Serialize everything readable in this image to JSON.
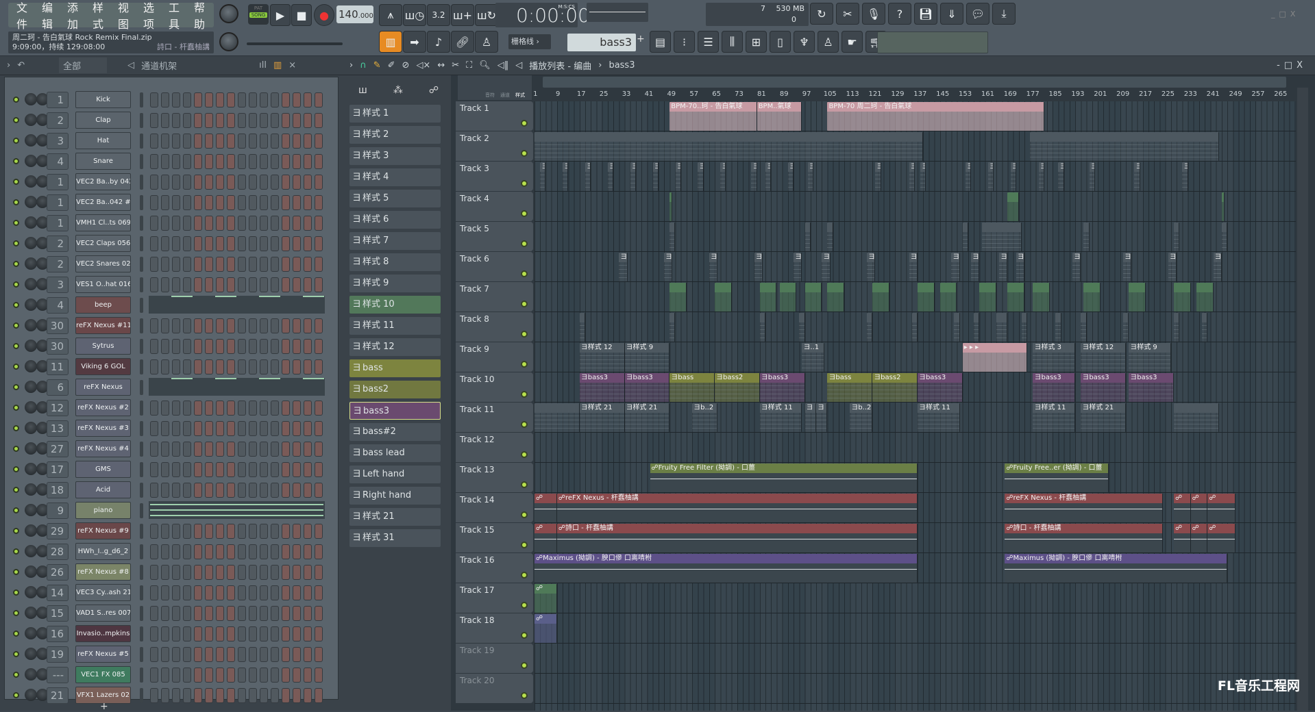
{
  "menu": [
    "文件",
    "编辑",
    "添加",
    "样式",
    "视图",
    "选项",
    "工具",
    "帮助"
  ],
  "hint": {
    "line1": "周二珂 - 告白氣球 Rock Remix Final.zip",
    "line2": "9:09:00，持续 129:08:00",
    "line3": "詩口 - 杆蠢柚講"
  },
  "transport": {
    "pat": "PAT",
    "song": "SONG",
    "tempo": "140",
    "tempo_frac": ".000",
    "time": "0:00:00",
    "time_unit": "M:S:CS",
    "cpu": "7",
    "mem": "530 MB",
    "poly": "0"
  },
  "snap": "栅格线",
  "pattern_selector": "bass3",
  "rack": {
    "filter": "全部",
    "title": "通道机架"
  },
  "playlist": {
    "title": "播放列表 - 编曲",
    "pattern": "bass3",
    "col_labels": [
      "音符",
      "通道",
      "样式"
    ]
  },
  "channels": [
    {
      "num": "1",
      "name": "Kick",
      "color": "#5b646c"
    },
    {
      "num": "2",
      "name": "Clap",
      "color": "#5b646c"
    },
    {
      "num": "3",
      "name": "Hat",
      "color": "#5b646c"
    },
    {
      "num": "4",
      "name": "Snare",
      "color": "#5b646c"
    },
    {
      "num": "1",
      "name": "VEC2 Ba..by 042",
      "color": "#5b646c"
    },
    {
      "num": "1",
      "name": "VEC2 Ba..042 #2",
      "color": "#5b646c"
    },
    {
      "num": "1",
      "name": "VMH1 Cl..ts 069",
      "color": "#5b646c"
    },
    {
      "num": "2",
      "name": "VEC2 Claps 056",
      "color": "#5b646c"
    },
    {
      "num": "2",
      "name": "VEC2 Snares 020",
      "color": "#5b646c"
    },
    {
      "num": "3",
      "name": "VES1 O..hat 016",
      "color": "#5b646c"
    },
    {
      "num": "4",
      "name": "beep",
      "color": "#6d4c4d",
      "roll": true
    },
    {
      "num": "30",
      "name": "reFX Nexus #11",
      "color": "#6a4749"
    },
    {
      "num": "30",
      "name": "Sytrus",
      "color": "#5e6372"
    },
    {
      "num": "11",
      "name": "Viking 6 GOL",
      "color": "#533a41"
    },
    {
      "num": "6",
      "name": "reFX Nexus",
      "color": "#5e6372",
      "roll": true
    },
    {
      "num": "12",
      "name": "reFX Nexus #2",
      "color": "#5e6372"
    },
    {
      "num": "13",
      "name": "reFX Nexus #3",
      "color": "#5e6372"
    },
    {
      "num": "27",
      "name": "reFX Nexus #4",
      "color": "#5e6372"
    },
    {
      "num": "17",
      "name": "GMS",
      "color": "#5e6372"
    },
    {
      "num": "18",
      "name": "Acid",
      "color": "#5e6372"
    },
    {
      "num": "9",
      "name": "piano",
      "color": "#77826a",
      "roll": "lines"
    },
    {
      "num": "29",
      "name": "reFX Nexus #9",
      "color": "#6a4749"
    },
    {
      "num": "28",
      "name": "HWh_I..g_d6_2",
      "color": "#5b646c"
    },
    {
      "num": "26",
      "name": "reFX Nexus #8",
      "color": "#7b8567"
    },
    {
      "num": "14",
      "name": "VEC3 Cy..ash 21",
      "color": "#5b646c"
    },
    {
      "num": "15",
      "name": "VAD1 S..res 007",
      "color": "#5b646c"
    },
    {
      "num": "16",
      "name": "Invasio..mpkins",
      "color": "#4e3641"
    },
    {
      "num": "19",
      "name": "reFX Nexus #5",
      "color": "#5e6372"
    },
    {
      "num": "---",
      "name": "VEC1 FX 085",
      "color": "#3f7b5f"
    },
    {
      "num": "21",
      "name": "VFX1 Lazers 02",
      "color": "#7a5f58"
    }
  ],
  "patterns": [
    {
      "name": "样式 1",
      "color": "#4a535b"
    },
    {
      "name": "样式 2",
      "color": "#4a535b"
    },
    {
      "name": "样式 3",
      "color": "#4a535b"
    },
    {
      "name": "样式 4",
      "color": "#4a535b"
    },
    {
      "name": "样式 5",
      "color": "#4a535b"
    },
    {
      "name": "样式 6",
      "color": "#4a535b"
    },
    {
      "name": "样式 7",
      "color": "#4a535b"
    },
    {
      "name": "样式 8",
      "color": "#4a535b"
    },
    {
      "name": "样式 9",
      "color": "#4a535b"
    },
    {
      "name": "样式 10",
      "color": "#52785a"
    },
    {
      "name": "样式 11",
      "color": "#4a535b"
    },
    {
      "name": "样式 12",
      "color": "#4a535b"
    },
    {
      "name": "bass",
      "color": "#7d843f"
    },
    {
      "name": "bass2",
      "color": "#717840"
    },
    {
      "name": "bass3",
      "color": "#6a4a6f",
      "selected": true
    },
    {
      "name": "bass#2",
      "color": "#4a535b"
    },
    {
      "name": "bass lead",
      "color": "#4a535b"
    },
    {
      "name": "Left hand",
      "color": "#4a535b"
    },
    {
      "name": "Right hand",
      "color": "#4a535b"
    },
    {
      "name": "样式 21",
      "color": "#4a535b"
    },
    {
      "name": "样式 31",
      "color": "#4a535b"
    }
  ],
  "ruler": [
    "1",
    "9",
    "17",
    "25",
    "33",
    "41",
    "49",
    "57",
    "65",
    "73",
    "81",
    "89",
    "97",
    "105",
    "113",
    "121",
    "129",
    "137",
    "145",
    "153",
    "161",
    "169",
    "177",
    "185",
    "193",
    "201",
    "209",
    "217",
    "225",
    "233",
    "241",
    "249",
    "257",
    "265"
  ],
  "tracks": [
    "Track 1",
    "Track 2",
    "Track 3",
    "Track 4",
    "Track 5",
    "Track 6",
    "Track 7",
    "Track 8",
    "Track 9",
    "Track 10",
    "Track 11",
    "Track 12",
    "Track 13",
    "Track 14",
    "Track 15",
    "Track 16",
    "Track 17",
    "Track 18",
    "Track 19",
    "Track 20"
  ],
  "clip_colors": {
    "audio": "#c79aa3",
    "pattern": "#4d5860",
    "green": "#4f7a58",
    "bass": "#7d843f",
    "bass3": "#6b4a70",
    "auto": "#8b4a4d",
    "max": "#5d5088",
    "filter": "#6b7f46",
    "blue": "#5a5f8a"
  },
  "clips": [
    {
      "t": 0,
      "s": 49,
      "e": 80,
      "k": "audio",
      "label": "BPM-70..珂 - 告白氣球"
    },
    {
      "t": 0,
      "s": 80,
      "e": 96,
      "k": "audio",
      "label": "BPM..氣球"
    },
    {
      "t": 0,
      "s": 105,
      "e": 182,
      "k": "audio",
      "label": "BPM-70 周二珂 - 告白氣球"
    },
    {
      "t": 1,
      "s": 1,
      "e": 139,
      "k": "pattern",
      "label": ""
    },
    {
      "t": 1,
      "s": 177,
      "e": 244,
      "k": "pattern",
      "label": ""
    },
    {
      "t": 2,
      "s": 3,
      "e": 5,
      "k": "pattern",
      "label": "ヨ"
    },
    {
      "t": 2,
      "s": 11,
      "e": 13,
      "k": "pattern",
      "label": "ヨ"
    },
    {
      "t": 2,
      "s": 19,
      "e": 21,
      "k": "pattern",
      "label": "ヨ"
    },
    {
      "t": 2,
      "s": 27,
      "e": 29,
      "k": "pattern",
      "label": "ヨ"
    },
    {
      "t": 2,
      "s": 35,
      "e": 37,
      "k": "pattern",
      "label": "ヨ"
    },
    {
      "t": 2,
      "s": 43,
      "e": 45,
      "k": "pattern",
      "label": "ヨ"
    },
    {
      "t": 2,
      "s": 51,
      "e": 53,
      "k": "pattern",
      "label": "ヨ"
    },
    {
      "t": 2,
      "s": 59,
      "e": 61,
      "k": "pattern",
      "label": "ヨ"
    },
    {
      "t": 2,
      "s": 67,
      "e": 69,
      "k": "pattern",
      "label": "ヨ"
    },
    {
      "t": 2,
      "s": 78,
      "e": 80,
      "k": "pattern",
      "label": "ヨ"
    },
    {
      "t": 2,
      "s": 83,
      "e": 85,
      "k": "pattern",
      "label": "ヨ"
    },
    {
      "t": 2,
      "s": 91,
      "e": 93,
      "k": "pattern",
      "label": "ヨ"
    },
    {
      "t": 2,
      "s": 98,
      "e": 100,
      "k": "pattern",
      "label": "ヨ"
    },
    {
      "t": 2,
      "s": 122,
      "e": 124,
      "k": "pattern",
      "label": "ヨ"
    },
    {
      "t": 2,
      "s": 134,
      "e": 136,
      "k": "pattern",
      "label": "ヨ"
    },
    {
      "t": 2,
      "s": 138,
      "e": 140,
      "k": "pattern",
      "label": "ヨ"
    },
    {
      "t": 2,
      "s": 154,
      "e": 156,
      "k": "pattern",
      "label": "ヨ"
    },
    {
      "t": 2,
      "s": 162,
      "e": 164,
      "k": "pattern",
      "label": "ヨ"
    },
    {
      "t": 2,
      "s": 170,
      "e": 172,
      "k": "pattern",
      "label": "ヨ"
    },
    {
      "t": 2,
      "s": 180,
      "e": 182,
      "k": "pattern",
      "label": "ヨ"
    },
    {
      "t": 2,
      "s": 187,
      "e": 189,
      "k": "pattern",
      "label": "ヨ"
    },
    {
      "t": 2,
      "s": 198,
      "e": 200,
      "k": "pattern",
      "label": "ヨ"
    },
    {
      "t": 2,
      "s": 214,
      "e": 216,
      "k": "pattern",
      "label": "ヨ"
    },
    {
      "t": 2,
      "s": 231,
      "e": 233,
      "k": "pattern",
      "label": "ヨ"
    },
    {
      "t": 3,
      "s": 49,
      "e": 50,
      "k": "green",
      "label": ""
    },
    {
      "t": 3,
      "s": 169,
      "e": 173,
      "k": "green",
      "label": ""
    },
    {
      "t": 3,
      "s": 245,
      "e": 246,
      "k": "green",
      "label": ""
    },
    {
      "t": 4,
      "s": 49,
      "e": 51,
      "k": "pattern",
      "label": ""
    },
    {
      "t": 4,
      "s": 97,
      "e": 99,
      "k": "pattern",
      "label": ""
    },
    {
      "t": 4,
      "s": 105,
      "e": 107,
      "k": "pattern",
      "label": ""
    },
    {
      "t": 4,
      "s": 153,
      "e": 155,
      "k": "pattern",
      "label": ""
    },
    {
      "t": 4,
      "s": 160,
      "e": 174,
      "k": "pattern",
      "label": ""
    },
    {
      "t": 4,
      "s": 196,
      "e": 198,
      "k": "pattern",
      "label": ""
    },
    {
      "t": 4,
      "s": 228,
      "e": 230,
      "k": "pattern",
      "label": ""
    },
    {
      "t": 4,
      "s": 245,
      "e": 247,
      "k": "pattern",
      "label": ""
    },
    {
      "t": 5,
      "s": 31,
      "e": 34,
      "k": "pattern",
      "label": "ヨ"
    },
    {
      "t": 5,
      "s": 47,
      "e": 50,
      "k": "pattern",
      "label": "ヨ"
    },
    {
      "t": 5,
      "s": 63,
      "e": 66,
      "k": "pattern",
      "label": "ヨ"
    },
    {
      "t": 5,
      "s": 79,
      "e": 82,
      "k": "pattern",
      "label": "ヨ"
    },
    {
      "t": 5,
      "s": 93,
      "e": 96,
      "k": "pattern",
      "label": "ヨ"
    },
    {
      "t": 5,
      "s": 103,
      "e": 106,
      "k": "pattern",
      "label": "ヨ"
    },
    {
      "t": 5,
      "s": 119,
      "e": 122,
      "k": "pattern",
      "label": "ヨ"
    },
    {
      "t": 5,
      "s": 134,
      "e": 137,
      "k": "pattern",
      "label": "ヨ"
    },
    {
      "t": 5,
      "s": 149,
      "e": 152,
      "k": "pattern",
      "label": "ヨ"
    },
    {
      "t": 5,
      "s": 156,
      "e": 159,
      "k": "pattern",
      "label": "ヨ"
    },
    {
      "t": 5,
      "s": 166,
      "e": 169,
      "k": "pattern",
      "label": "ヨ"
    },
    {
      "t": 5,
      "s": 172,
      "e": 175,
      "k": "pattern",
      "label": "ヨ"
    },
    {
      "t": 5,
      "s": 192,
      "e": 195,
      "k": "pattern",
      "label": "ヨ"
    },
    {
      "t": 5,
      "s": 210,
      "e": 213,
      "k": "pattern",
      "label": "ヨ"
    },
    {
      "t": 5,
      "s": 226,
      "e": 229,
      "k": "pattern",
      "label": "ヨ"
    },
    {
      "t": 5,
      "s": 242,
      "e": 245,
      "k": "pattern",
      "label": "ヨ"
    },
    {
      "t": 6,
      "s": 49,
      "e": 55,
      "k": "green",
      "label": ""
    },
    {
      "t": 6,
      "s": 65,
      "e": 71,
      "k": "green",
      "label": ""
    },
    {
      "t": 6,
      "s": 81,
      "e": 87,
      "k": "green",
      "label": ""
    },
    {
      "t": 6,
      "s": 88,
      "e": 94,
      "k": "green",
      "label": ""
    },
    {
      "t": 6,
      "s": 97,
      "e": 103,
      "k": "green",
      "label": ""
    },
    {
      "t": 6,
      "s": 105,
      "e": 111,
      "k": "green",
      "label": ""
    },
    {
      "t": 6,
      "s": 121,
      "e": 127,
      "k": "green",
      "label": ""
    },
    {
      "t": 6,
      "s": 137,
      "e": 143,
      "k": "green",
      "label": ""
    },
    {
      "t": 6,
      "s": 145,
      "e": 151,
      "k": "green",
      "label": ""
    },
    {
      "t": 6,
      "s": 159,
      "e": 165,
      "k": "green",
      "label": ""
    },
    {
      "t": 6,
      "s": 169,
      "e": 175,
      "k": "green",
      "label": ""
    },
    {
      "t": 6,
      "s": 178,
      "e": 184,
      "k": "green",
      "label": ""
    },
    {
      "t": 6,
      "s": 196,
      "e": 202,
      "k": "green",
      "label": ""
    },
    {
      "t": 6,
      "s": 212,
      "e": 218,
      "k": "green",
      "label": ""
    },
    {
      "t": 6,
      "s": 228,
      "e": 234,
      "k": "green",
      "label": ""
    },
    {
      "t": 6,
      "s": 236,
      "e": 242,
      "k": "green",
      "label": ""
    },
    {
      "t": 7,
      "s": 17,
      "e": 19,
      "k": "pattern",
      "label": ""
    },
    {
      "t": 7,
      "s": 49,
      "e": 51,
      "k": "pattern",
      "label": ""
    },
    {
      "t": 7,
      "s": 81,
      "e": 83,
      "k": "pattern",
      "label": ""
    },
    {
      "t": 7,
      "s": 95,
      "e": 97,
      "k": "pattern",
      "label": ""
    },
    {
      "t": 7,
      "s": 119,
      "e": 121,
      "k": "pattern",
      "label": ""
    },
    {
      "t": 7,
      "s": 135,
      "e": 137,
      "k": "pattern",
      "label": ""
    },
    {
      "t": 7,
      "s": 150,
      "e": 152,
      "k": "pattern",
      "label": ""
    },
    {
      "t": 7,
      "s": 157,
      "e": 159,
      "k": "pattern",
      "label": ""
    },
    {
      "t": 7,
      "s": 165,
      "e": 169,
      "k": "pattern",
      "label": ""
    },
    {
      "t": 7,
      "s": 174,
      "e": 176,
      "k": "pattern",
      "label": ""
    },
    {
      "t": 7,
      "s": 186,
      "e": 188,
      "k": "pattern",
      "label": ""
    },
    {
      "t": 7,
      "s": 195,
      "e": 197,
      "k": "pattern",
      "label": ""
    },
    {
      "t": 7,
      "s": 210,
      "e": 212,
      "k": "pattern",
      "label": ""
    },
    {
      "t": 7,
      "s": 228,
      "e": 230,
      "k": "pattern",
      "label": ""
    },
    {
      "t": 7,
      "s": 238,
      "e": 240,
      "k": "pattern",
      "label": ""
    },
    {
      "t": 8,
      "s": 17,
      "e": 33,
      "k": "pattern",
      "label": "ヨ样式 12"
    },
    {
      "t": 8,
      "s": 33,
      "e": 49,
      "k": "pattern",
      "label": "ヨ样式 9"
    },
    {
      "t": 8,
      "s": 96,
      "e": 104,
      "k": "pattern",
      "label": "ヨ..1"
    },
    {
      "t": 8,
      "s": 153,
      "e": 176,
      "k": "audio",
      "label": "▸ ▸ ▸"
    },
    {
      "t": 8,
      "s": 178,
      "e": 193,
      "k": "pattern",
      "label": "ヨ样式 3"
    },
    {
      "t": 8,
      "s": 195,
      "e": 211,
      "k": "pattern",
      "label": "ヨ样式 12"
    },
    {
      "t": 8,
      "s": 212,
      "e": 227,
      "k": "pattern",
      "label": "ヨ样式 9"
    },
    {
      "t": 9,
      "s": 17,
      "e": 33,
      "k": "bass3",
      "label": "ヨbass3"
    },
    {
      "t": 9,
      "s": 33,
      "e": 49,
      "k": "bass3",
      "label": "ヨbass3"
    },
    {
      "t": 9,
      "s": 49,
      "e": 65,
      "k": "bass",
      "label": "ヨbass"
    },
    {
      "t": 9,
      "s": 65,
      "e": 81,
      "k": "bass",
      "label": "ヨbass2"
    },
    {
      "t": 9,
      "s": 81,
      "e": 97,
      "k": "bass3",
      "label": "ヨbass3"
    },
    {
      "t": 9,
      "s": 105,
      "e": 121,
      "k": "bass",
      "label": "ヨbass"
    },
    {
      "t": 9,
      "s": 121,
      "e": 137,
      "k": "bass",
      "label": "ヨbass2"
    },
    {
      "t": 9,
      "s": 137,
      "e": 153,
      "k": "bass3",
      "label": "ヨbass3"
    },
    {
      "t": 9,
      "s": 178,
      "e": 193,
      "k": "bass3",
      "label": "ヨbass3"
    },
    {
      "t": 9,
      "s": 195,
      "e": 211,
      "k": "bass3",
      "label": "ヨbass3"
    },
    {
      "t": 9,
      "s": 212,
      "e": 228,
      "k": "bass3",
      "label": "ヨbass3"
    },
    {
      "t": 10,
      "s": 1,
      "e": 17,
      "k": "pattern",
      "label": ""
    },
    {
      "t": 10,
      "s": 17,
      "e": 33,
      "k": "pattern",
      "label": "ヨ样式 21"
    },
    {
      "t": 10,
      "s": 33,
      "e": 49,
      "k": "pattern",
      "label": "ヨ样式 21"
    },
    {
      "t": 10,
      "s": 57,
      "e": 66,
      "k": "pattern",
      "label": "ヨb..2"
    },
    {
      "t": 10,
      "s": 81,
      "e": 96,
      "k": "pattern",
      "label": "ヨ样式 11"
    },
    {
      "t": 10,
      "s": 97,
      "e": 101,
      "k": "pattern",
      "label": "ヨ"
    },
    {
      "t": 10,
      "s": 101,
      "e": 105,
      "k": "pattern",
      "label": "ヨ"
    },
    {
      "t": 10,
      "s": 113,
      "e": 121,
      "k": "pattern",
      "label": "ヨb..2"
    },
    {
      "t": 10,
      "s": 137,
      "e": 152,
      "k": "pattern",
      "label": "ヨ样式 11"
    },
    {
      "t": 10,
      "s": 178,
      "e": 193,
      "k": "pattern",
      "label": "ヨ样式 11"
    },
    {
      "t": 10,
      "s": 195,
      "e": 211,
      "k": "pattern",
      "label": "ヨ样式 21"
    },
    {
      "t": 10,
      "s": 228,
      "e": 244,
      "k": "pattern",
      "label": ""
    },
    {
      "t": 12,
      "s": 42,
      "e": 137,
      "k": "filter",
      "label": "☍Fruity Free Filter (拗調) - 口薑"
    },
    {
      "t": 12,
      "s": 168,
      "e": 205,
      "k": "filter",
      "label": "☍Fruity Free..er (拗調) - 口薑"
    },
    {
      "t": 13,
      "s": 1,
      "e": 9,
      "k": "auto",
      "label": "☍"
    },
    {
      "t": 13,
      "s": 9,
      "e": 137,
      "k": "auto",
      "label": "☍reFX Nexus - 杆蠢柚講"
    },
    {
      "t": 13,
      "s": 168,
      "e": 224,
      "k": "auto",
      "label": "☍reFX Nexus - 杆蠢柚講"
    },
    {
      "t": 13,
      "s": 228,
      "e": 234,
      "k": "auto",
      "label": "☍"
    },
    {
      "t": 13,
      "s": 234,
      "e": 240,
      "k": "auto",
      "label": "☍"
    },
    {
      "t": 13,
      "s": 240,
      "e": 250,
      "k": "auto",
      "label": "☍"
    },
    {
      "t": 14,
      "s": 1,
      "e": 9,
      "k": "auto",
      "label": "☍"
    },
    {
      "t": 14,
      "s": 9,
      "e": 137,
      "k": "auto",
      "label": "☍詩口 - 杆蠢柚講"
    },
    {
      "t": 14,
      "s": 168,
      "e": 224,
      "k": "auto",
      "label": "☍詩口 - 杆蠢柚講"
    },
    {
      "t": 14,
      "s": 228,
      "e": 234,
      "k": "auto",
      "label": "☍"
    },
    {
      "t": 14,
      "s": 234,
      "e": 240,
      "k": "auto",
      "label": "☍"
    },
    {
      "t": 14,
      "s": 240,
      "e": 250,
      "k": "auto",
      "label": "☍"
    },
    {
      "t": 15,
      "s": 1,
      "e": 137,
      "k": "max",
      "label": "☍Maximus (拗調) - 腴口傪 口离啨柎"
    },
    {
      "t": 15,
      "s": 168,
      "e": 247,
      "k": "max",
      "label": "☍Maximus (拗調) - 腴口傪 口离啨柎"
    },
    {
      "t": 16,
      "s": 1,
      "e": 9,
      "k": "green",
      "label": "☍"
    },
    {
      "t": 17,
      "s": 1,
      "e": 9,
      "k": "blue",
      "label": "☍"
    }
  ],
  "watermark": "FL音乐工程网"
}
